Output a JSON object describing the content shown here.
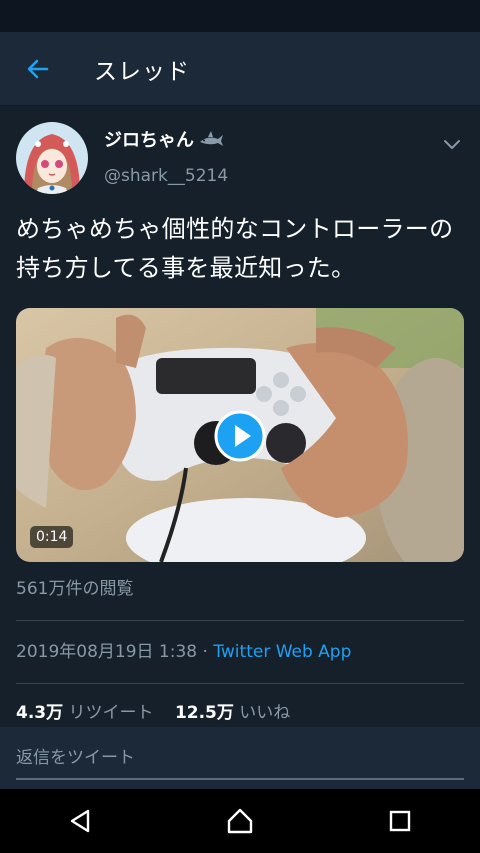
{
  "appbar": {
    "title": "スレッド"
  },
  "tweet": {
    "display_name": "ジロちゃん",
    "username": "@shark__5214",
    "text": "めちゃめちゃ個性的なコントローラーの持ち方してる事を最近知った。",
    "media": {
      "duration": "0:14"
    },
    "views": "561万件の閲覧",
    "datetime": "2019年08月19日 1:38",
    "separator": " · ",
    "via": "Twitter Web App",
    "retweets_count": "4.3万",
    "retweets_label": "リツイート",
    "likes_count": "12.5万",
    "likes_label": "いいね"
  },
  "reply": {
    "placeholder": "返信をツイート"
  },
  "colors": {
    "background": "#15202b",
    "appbar": "#1c2938",
    "accent": "#1da1f2",
    "muted": "#8899a6"
  }
}
